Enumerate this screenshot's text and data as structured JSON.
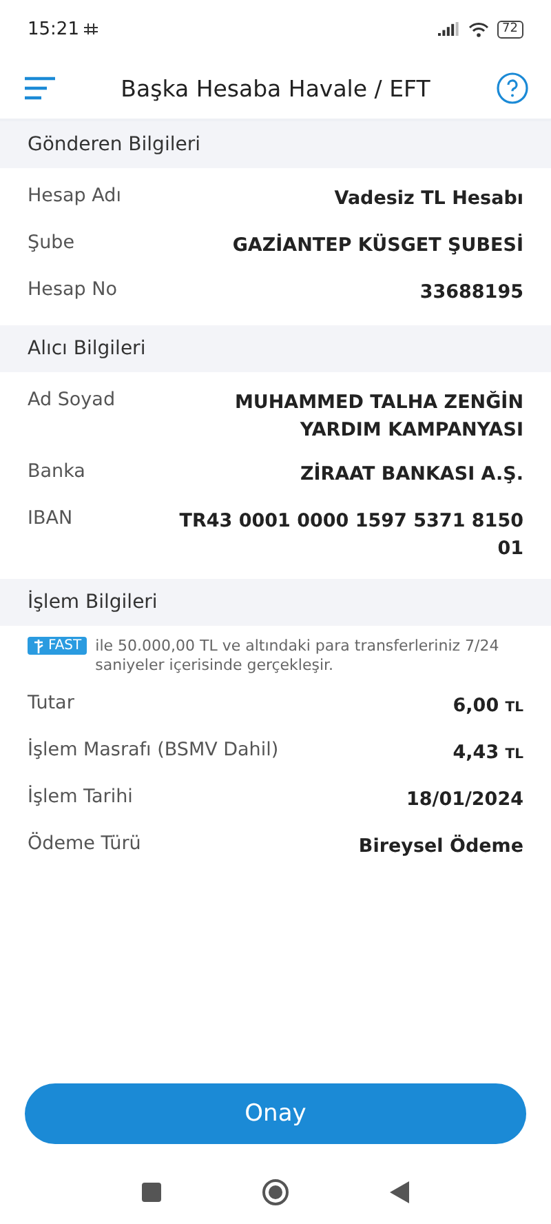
{
  "status_bar": {
    "time": "15:21",
    "battery": "72"
  },
  "header": {
    "title": "Başka Hesaba Havale / EFT"
  },
  "sections": [
    {
      "title": "Gönderen Bilgileri",
      "rows": [
        {
          "label": "Hesap Adı",
          "value": "Vadesiz TL Hesabı"
        },
        {
          "label": "Şube",
          "value": "GAZİANTEP KÜSGET ŞUBESİ"
        },
        {
          "label": "Hesap No",
          "value": "33688195"
        }
      ]
    },
    {
      "title": "Alıcı Bilgileri",
      "rows": [
        {
          "label": "Ad Soyad",
          "value": "MUHAMMED TALHA ZENĞİN YARDIM KAMPANYASI"
        },
        {
          "label": "Banka",
          "value": "ZİRAAT BANKASI A.Ş."
        },
        {
          "label": "IBAN",
          "value": "TR43 0001 0000 1597 5371 8150 01"
        }
      ]
    },
    {
      "title": "İşlem Bilgileri",
      "notice": {
        "badge": "FAST",
        "text": "ile 50.000,00 TL ve altındaki para transferleriniz 7/24 saniyeler içerisinde gerçekleşir."
      },
      "rows": [
        {
          "label": "Tutar",
          "value": "6,00",
          "unit": "TL"
        },
        {
          "label": "İşlem Masrafı (BSMV Dahil)",
          "value": "4,43",
          "unit": "TL"
        },
        {
          "label": "İşlem Tarihi",
          "value": "18/01/2024"
        },
        {
          "label": "Ödeme Türü",
          "value": "Bireysel Ödeme"
        }
      ]
    }
  ],
  "confirm_button": "Onay"
}
